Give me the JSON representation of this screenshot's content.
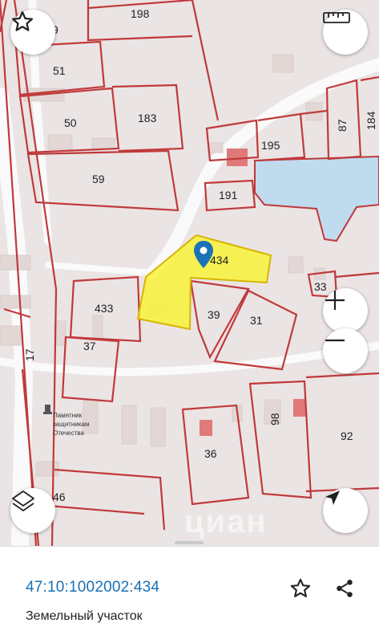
{
  "map": {
    "plots": [
      "198",
      "9",
      "51",
      "50",
      "183",
      "59",
      "195",
      "191",
      "87",
      "184",
      "434",
      "433",
      "39",
      "31",
      "33",
      "17",
      "37",
      "36",
      "98",
      "92",
      "46"
    ],
    "monument_label": [
      "Памятник",
      "защитникам",
      "Отечества"
    ],
    "watermark": "циан",
    "colors": {
      "boundary": "#c0393b",
      "selected_fill": "#f8f23a",
      "water": "#bfdcef",
      "pin": "#1a73b7"
    },
    "icons": [
      "star-icon",
      "ruler-icon",
      "zoom-in-icon",
      "zoom-out-icon",
      "layers-icon",
      "locate-icon",
      "map-pin-icon"
    ]
  },
  "sheet": {
    "cadastral_number": "47:10:1002002:434",
    "object_type": "Земельный участок",
    "icons": [
      "star-outline-icon",
      "share-icon"
    ]
  }
}
